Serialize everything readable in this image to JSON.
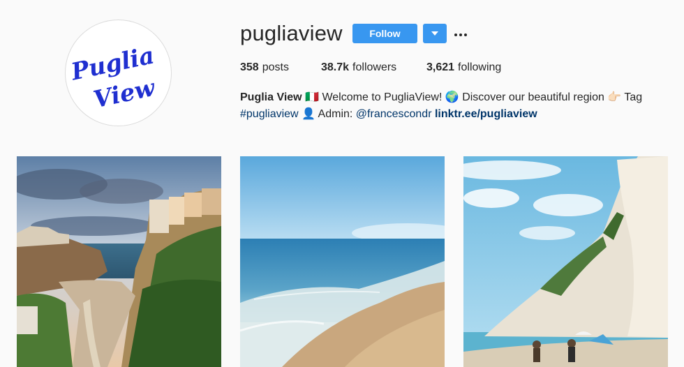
{
  "profile": {
    "avatar_text": "Puglia View",
    "username": "pugliaview",
    "follow_label": "Follow",
    "stats": {
      "posts_count": "358",
      "posts_label": "posts",
      "followers_count": "38.7k",
      "followers_label": "followers",
      "following_count": "3,621",
      "following_label": "following"
    },
    "bio": {
      "name": "Puglia View",
      "flag": "🇮🇹",
      "text1": " Welcome to PugliaView! ",
      "globe": "🌍",
      "text2": " Discover our beautiful region ",
      "hand": "👉🏻",
      "text3": " Tag",
      "hashtag": "#pugliaview",
      "person": "👤",
      "text4": " Admin: ",
      "mention": "@francescondr",
      "link": "linktr.ee/pugliaview"
    }
  },
  "colors": {
    "accent": "#3897f0",
    "link": "#003569",
    "avatar_text": "#1f2fd0"
  },
  "icons": {
    "dropdown": "chevron-down-icon",
    "more": "more-options-icon"
  },
  "posts": [
    {
      "subject": "cliff town by the sea"
    },
    {
      "subject": "beach shoreline"
    },
    {
      "subject": "white cliffs beach"
    }
  ]
}
